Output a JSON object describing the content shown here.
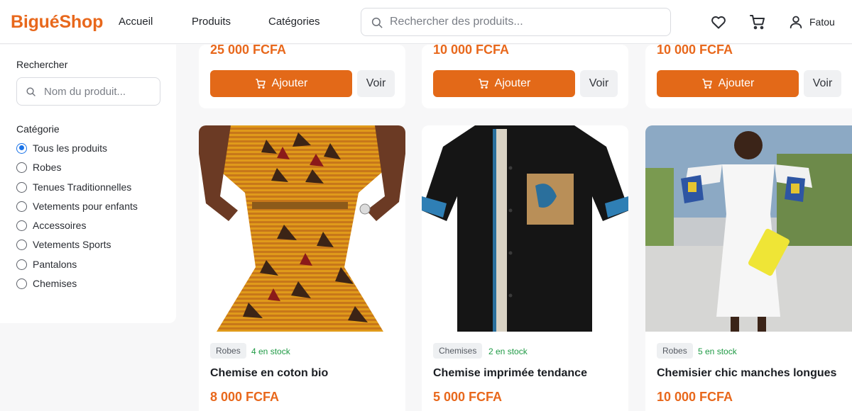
{
  "header": {
    "logo": "BiguéShop",
    "nav": [
      "Accueil",
      "Produits",
      "Catégories"
    ],
    "search_placeholder": "Rechercher des produits...",
    "user_name": "Fatou"
  },
  "sidebar": {
    "search_label": "Rechercher",
    "search_placeholder": "Nom du produit...",
    "category_label": "Catégorie",
    "categories": [
      {
        "label": "Tous les produits",
        "checked": true
      },
      {
        "label": "Robes",
        "checked": false
      },
      {
        "label": "Tenues Traditionnelles",
        "checked": false
      },
      {
        "label": "Vetements pour enfants",
        "checked": false
      },
      {
        "label": "Accessoires",
        "checked": false
      },
      {
        "label": "Vetements Sports",
        "checked": false
      },
      {
        "label": "Pantalons",
        "checked": false
      },
      {
        "label": "Chemises",
        "checked": false
      }
    ]
  },
  "buttons": {
    "add": "Ajouter",
    "view": "Voir"
  },
  "top_row": [
    {
      "price": "25 000 FCFA"
    },
    {
      "price": "10 000 FCFA"
    },
    {
      "price": "10 000 FCFA"
    }
  ],
  "products": [
    {
      "category": "Robes",
      "stock": "4 en stock",
      "name": "Chemise en coton bio",
      "price": "8 000 FCFA"
    },
    {
      "category": "Chemises",
      "stock": "2 en stock",
      "name": "Chemise imprimée tendance",
      "price": "5 000 FCFA"
    },
    {
      "category": "Robes",
      "stock": "5 en stock",
      "name": "Chemisier chic manches longues",
      "price": "10 000 FCFA"
    }
  ],
  "colors": {
    "brand": "#e8681c",
    "button": "#e36918",
    "stock": "#1f9a45",
    "radio": "#1a73e8"
  }
}
